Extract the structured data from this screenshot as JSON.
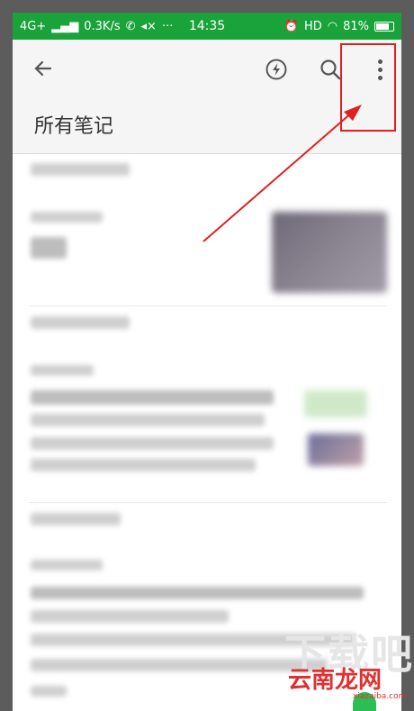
{
  "status_bar": {
    "network": "4G+",
    "speed": "0.3K/s",
    "more": "···",
    "time": "14:35",
    "hd": "HD",
    "battery": "81%",
    "battery_level": 0.81
  },
  "app_bar": {
    "title": "所有笔记"
  },
  "watermark": {
    "text": "云南龙网",
    "sub": "xiazaiba.com",
    "bg": "下载吧"
  },
  "colors": {
    "status_bar": "#1aa33a",
    "annotation": "#e02020"
  }
}
